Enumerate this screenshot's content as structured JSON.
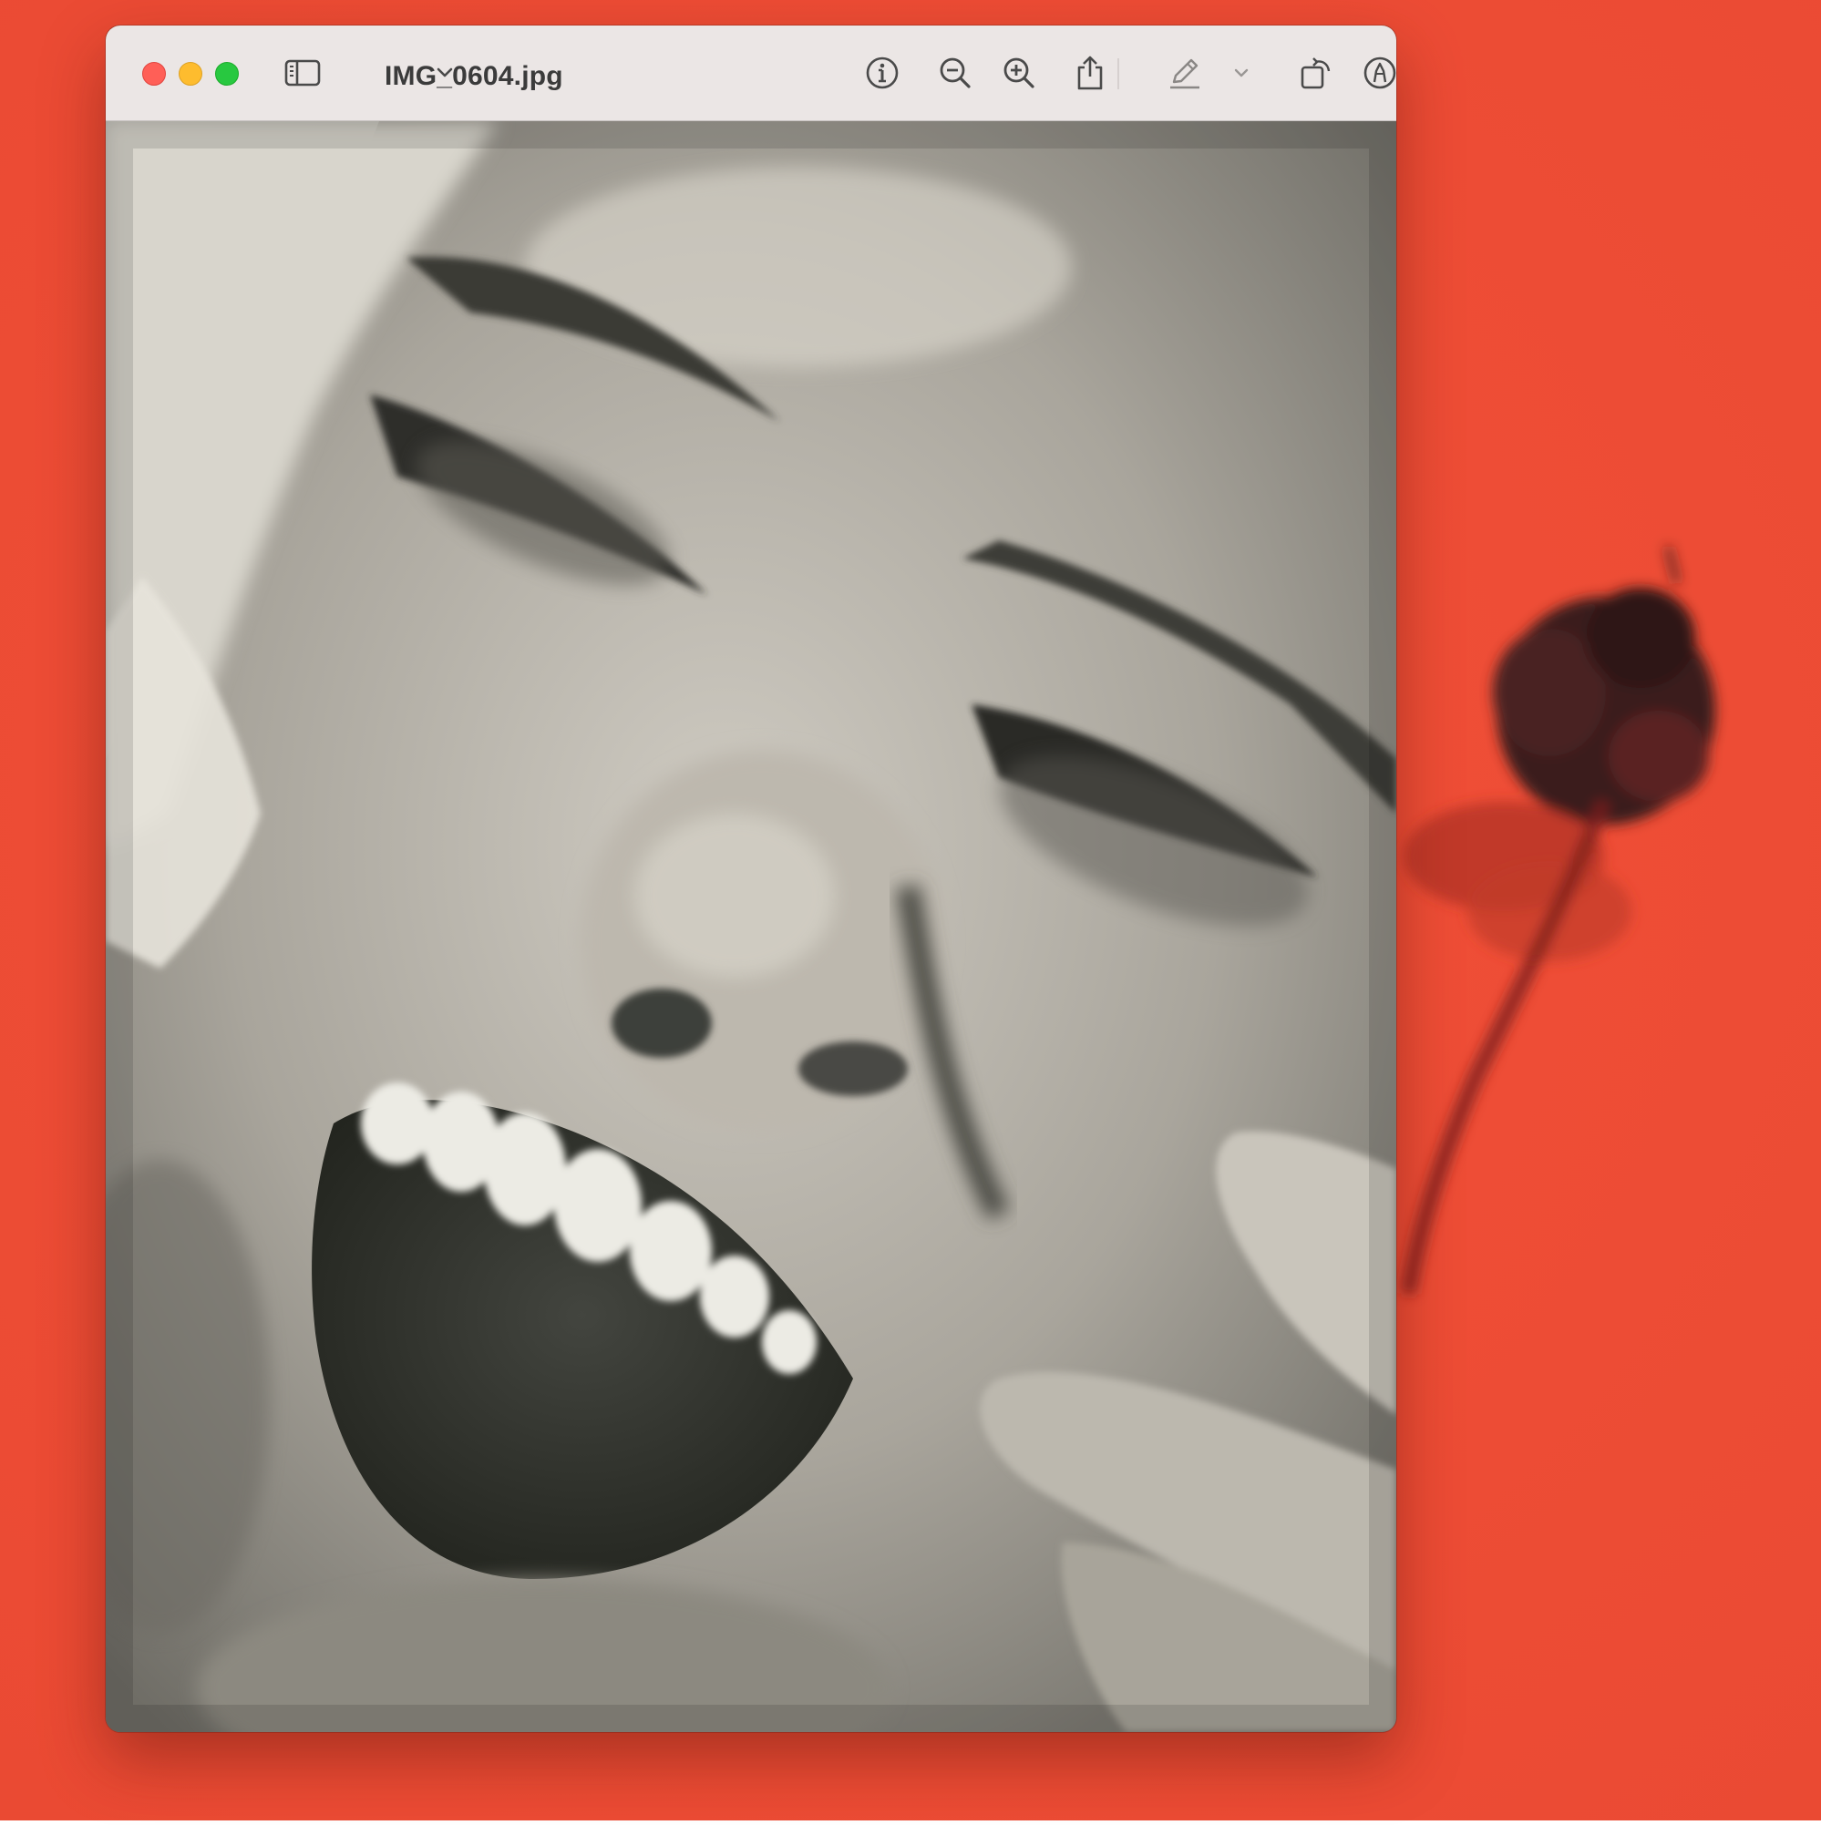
{
  "desktop": {
    "background_color": "#f0503a"
  },
  "window": {
    "title": "IMG_0604.jpg",
    "traffic_lights": {
      "close": "#ff5f57",
      "minimize": "#febc2e",
      "zoom": "#28c840"
    }
  },
  "toolbar": {
    "buttons": [
      {
        "name": "sidebar-toggle",
        "icon": "sidebar-icon"
      },
      {
        "name": "view-menu",
        "icon": "chevron-down-icon"
      },
      {
        "name": "info",
        "icon": "info-icon"
      },
      {
        "name": "zoom-out",
        "icon": "zoom-out-icon"
      },
      {
        "name": "zoom-in",
        "icon": "zoom-in-icon"
      },
      {
        "name": "share",
        "icon": "share-icon"
      },
      {
        "name": "markup",
        "icon": "pencil-icon"
      },
      {
        "name": "markup-menu",
        "icon": "chevron-down-icon"
      },
      {
        "name": "rotate",
        "icon": "rotate-icon"
      },
      {
        "name": "annotate",
        "icon": "pen-tip-circle-icon"
      },
      {
        "name": "search",
        "icon": "search-icon"
      }
    ]
  },
  "image": {
    "description_type": "monochrome portrait photo",
    "tone": "#9a9890"
  }
}
